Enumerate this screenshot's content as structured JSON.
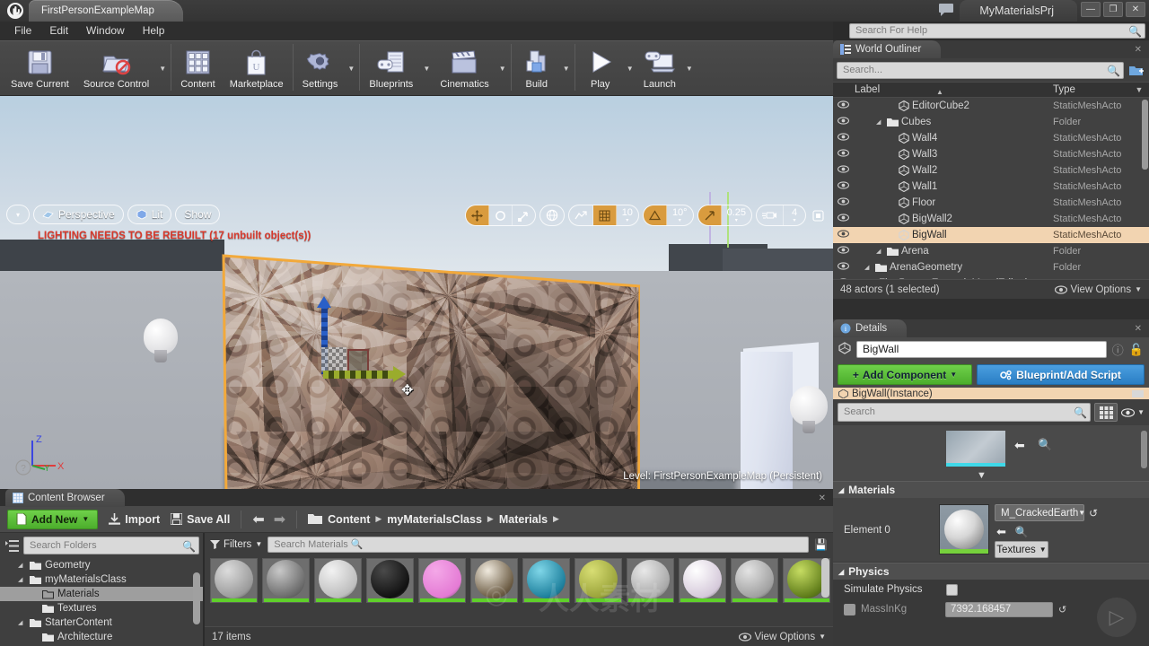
{
  "titlebar": {
    "logo": "unreal-u",
    "left_tab": "FirstPersonExampleMap",
    "project_tab": "MyMaterialsPrj",
    "minimize": "—",
    "maximize": "❐",
    "close": "✕"
  },
  "menubar": {
    "items": [
      "File",
      "Edit",
      "Window",
      "Help"
    ]
  },
  "help_search": {
    "placeholder": "Search For Help",
    "value": ""
  },
  "toolbar": {
    "buttons": [
      {
        "label": "Save Current",
        "icon": "floppy-disk-icon",
        "dropdown": false
      },
      {
        "label": "Source Control",
        "icon": "source-control-icon",
        "dropdown": true
      },
      {
        "label": "Content",
        "icon": "content-grid-icon",
        "dropdown": false
      },
      {
        "label": "Marketplace",
        "icon": "shopping-bag-icon",
        "dropdown": false
      },
      {
        "label": "Settings",
        "icon": "gear-icon",
        "dropdown": true
      },
      {
        "label": "Blueprints",
        "icon": "blueprint-icon",
        "dropdown": true
      },
      {
        "label": "Cinematics",
        "icon": "clapperboard-icon",
        "dropdown": true
      },
      {
        "label": "Build",
        "icon": "build-icon",
        "dropdown": true
      },
      {
        "label": "Play",
        "icon": "play-icon",
        "dropdown": true
      },
      {
        "label": "Launch",
        "icon": "launch-icon",
        "dropdown": true
      }
    ]
  },
  "viewport": {
    "view_dropdown": "▾",
    "perspective": "Perspective",
    "lit": "Lit",
    "show": "Show",
    "warning": "LIGHTING NEEDS TO BE REBUILT (17 unbuilt object(s))",
    "level_label": "Level:  FirstPersonExampleMap (Persistent)",
    "transform_tools": [
      "move-tool-icon",
      "rotate-tool-icon",
      "scale-tool-icon"
    ],
    "coord_space": "world-space-icon",
    "surface_snap": "surface-snap-icon",
    "grid_snap_icon": "grid-snap-icon",
    "grid_snap_value": "10",
    "rotation_snap_icon": "rotation-snap-icon",
    "rotation_snap_value": "10°",
    "scale_snap_icon": "scale-snap-icon",
    "scale_snap_value": "0.25",
    "camera_speed_icon": "camera-speed-icon",
    "camera_speed_value": "4",
    "maximize_icon": "maximize-viewport-icon",
    "axes": {
      "z": "Z",
      "y": "Y",
      "x": "X"
    }
  },
  "outliner": {
    "tab_title": "World Outliner",
    "search_placeholder": "Search...",
    "columns": {
      "label": "Label",
      "type": "Type"
    },
    "rows": [
      {
        "label": "FirstPersonExampleMap (Editor)",
        "type": "World",
        "indent": 0,
        "icon": "world-icon",
        "expandable": true,
        "selected": false
      },
      {
        "label": "ArenaGeometry",
        "type": "Folder",
        "indent": 1,
        "icon": "folder-icon",
        "expandable": true,
        "selected": false
      },
      {
        "label": "Arena",
        "type": "Folder",
        "indent": 2,
        "icon": "folder-icon",
        "expandable": true,
        "selected": false
      },
      {
        "label": "BigWall",
        "type": "StaticMeshActo",
        "indent": 3,
        "icon": "mesh-icon",
        "expandable": false,
        "selected": true
      },
      {
        "label": "BigWall2",
        "type": "StaticMeshActo",
        "indent": 3,
        "icon": "mesh-icon",
        "expandable": false,
        "selected": false
      },
      {
        "label": "Floor",
        "type": "StaticMeshActo",
        "indent": 3,
        "icon": "mesh-icon",
        "expandable": false,
        "selected": false
      },
      {
        "label": "Wall1",
        "type": "StaticMeshActo",
        "indent": 3,
        "icon": "mesh-icon",
        "expandable": false,
        "selected": false
      },
      {
        "label": "Wall2",
        "type": "StaticMeshActo",
        "indent": 3,
        "icon": "mesh-icon",
        "expandable": false,
        "selected": false
      },
      {
        "label": "Wall3",
        "type": "StaticMeshActo",
        "indent": 3,
        "icon": "mesh-icon",
        "expandable": false,
        "selected": false
      },
      {
        "label": "Wall4",
        "type": "StaticMeshActo",
        "indent": 3,
        "icon": "mesh-icon",
        "expandable": false,
        "selected": false
      },
      {
        "label": "Cubes",
        "type": "Folder",
        "indent": 2,
        "icon": "folder-icon",
        "expandable": true,
        "selected": false
      },
      {
        "label": "EditorCube2",
        "type": "StaticMeshActo",
        "indent": 3,
        "icon": "mesh-icon",
        "expandable": false,
        "selected": false
      }
    ],
    "footer_status": "48 actors (1 selected)",
    "view_options": "View Options"
  },
  "details": {
    "tab_title": "Details",
    "actor_name": "BigWall",
    "add_component": "Add Component",
    "blueprint_script": "Blueprint/Add Script",
    "instance_row": "BigWall(Instance)",
    "search_placeholder": "Search",
    "materials_section": "Materials",
    "element_label": "Element 0",
    "material_name": "M_CrackedEarth",
    "textures_button": "Textures",
    "physics_section": "Physics",
    "simulate_physics_label": "Simulate Physics",
    "mass_label": "MassInKg",
    "mass_value": "7392.168457"
  },
  "content_browser": {
    "tab_title": "Content Browser",
    "add_new": "Add New",
    "import": "Import",
    "save_all": "Save All",
    "breadcrumb": [
      "Content",
      "myMaterialsClass",
      "Materials"
    ],
    "folder_search_placeholder": "Search Folders",
    "folders": [
      {
        "label": "Geometry",
        "indent": 1,
        "expandable": true,
        "selected": false
      },
      {
        "label": "myMaterialsClass",
        "indent": 1,
        "expandable": true,
        "selected": false
      },
      {
        "label": "Materials",
        "indent": 2,
        "expandable": false,
        "selected": true
      },
      {
        "label": "Textures",
        "indent": 2,
        "expandable": false,
        "selected": false
      },
      {
        "label": "StarterContent",
        "indent": 1,
        "expandable": true,
        "selected": false
      },
      {
        "label": "Architecture",
        "indent": 2,
        "expandable": false,
        "selected": false
      }
    ],
    "filters_label": "Filters",
    "asset_search_placeholder": "Search Materials",
    "assets": [
      {
        "color_a": "#dcdcdc",
        "color_b": "#9a9a9a"
      },
      {
        "color_a": "#c8c8c8",
        "color_b": "#6a6a6a"
      },
      {
        "color_a": "#f2f2f2",
        "color_b": "#bdbdbd"
      },
      {
        "color_a": "#4a4a4a",
        "color_b": "#111111"
      },
      {
        "color_a": "#f4a8e8",
        "color_b": "#e47ad4"
      },
      {
        "color_a": "#f0eade",
        "color_b": "#6a5a42"
      },
      {
        "color_a": "#7fd6e8",
        "color_b": "#1d7f9c"
      },
      {
        "color_a": "#d8de74",
        "color_b": "#9aa33a"
      },
      {
        "color_a": "#e8e8e8",
        "color_b": "#a8a8a8"
      },
      {
        "color_a": "#ffffff",
        "color_b": "#d5c9da"
      },
      {
        "color_a": "#e3e3e3",
        "color_b": "#a0a0a0"
      },
      {
        "color_a": "#c6dc62",
        "color_b": "#5d7a18"
      }
    ],
    "item_count": "17 items",
    "view_options": "View Options"
  }
}
